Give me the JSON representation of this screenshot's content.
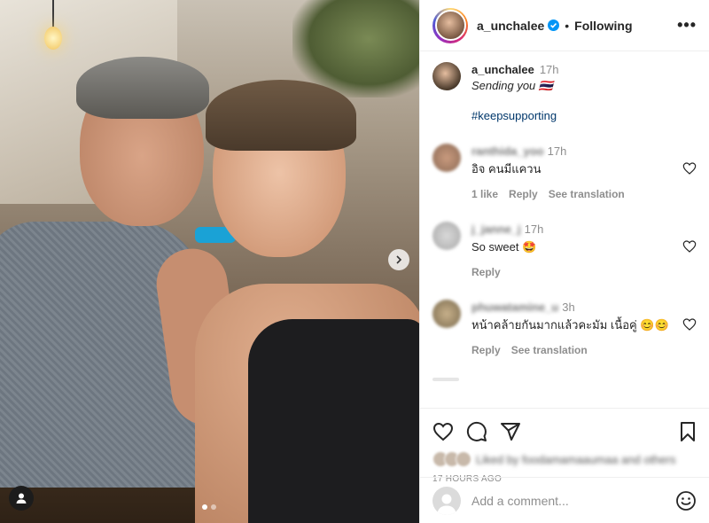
{
  "post": {
    "username": "a_unchalee",
    "follow_state": "Following",
    "separator": "•",
    "more": "•••",
    "caption": {
      "time": "17h",
      "message": "Sending you 🇹🇭",
      "hashtag": "#keepsupporting"
    },
    "carousel": {
      "total": 2,
      "current": 1
    }
  },
  "comments": [
    {
      "user": "ranthida_yoo",
      "time": "17h",
      "text": "อิจ คนมีแควน",
      "actions": [
        "1 like",
        "Reply",
        "See translation"
      ]
    },
    {
      "user": "j_janne_j",
      "time": "17h",
      "text": "So sweet 🤩",
      "actions": [
        "Reply"
      ]
    },
    {
      "user": "phuwatamine_u",
      "time": "3h",
      "text": "หน้าคล้ายกันมากแล้วคะมัม เนื้อคู่ 😊😊",
      "actions": [
        "Reply",
        "See translation"
      ]
    }
  ],
  "footer": {
    "liked_by": "Liked by foodamamaaumaa and others",
    "timestamp": "17 HOURS AGO",
    "comment_placeholder": "Add a comment..."
  },
  "colors": {
    "link": "#00376b",
    "muted": "#8e8e8e",
    "verified": "#0095f6",
    "watch": "#1aa2d6"
  },
  "icons": [
    "verified-badge-icon",
    "more-icon",
    "chevron-right-icon",
    "user-tag-icon",
    "heart-icon",
    "comment-icon",
    "share-icon",
    "bookmark-icon",
    "emoji-icon"
  ]
}
